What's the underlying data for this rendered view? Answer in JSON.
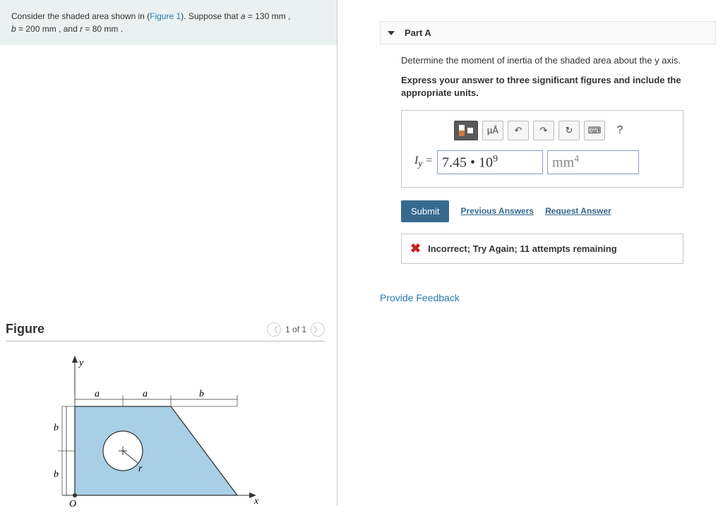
{
  "problem": {
    "text_prefix": "Consider the shaded area shown in (",
    "figure_link": "Figure 1",
    "text_suffix": "). Suppose that ",
    "a_label": "a",
    "a_value": " = 130  mm",
    "sep1": " , ",
    "b_label": "b",
    "b_value": " = 200  mm",
    "sep2": " , and ",
    "r_label": "r",
    "r_value": " = 80  mm",
    "tail": " ."
  },
  "figure": {
    "title": "Figure",
    "nav_text": "1 of 1",
    "labels": {
      "y": "y",
      "x": "x",
      "O": "O",
      "a": "a",
      "b": "b",
      "r": "r"
    }
  },
  "part": {
    "label": "Part A",
    "question": "Determine the moment of inertia of the shaded area about the y axis.",
    "instruction": "Express your answer to three significant figures and include the appropriate units."
  },
  "toolbar": {
    "units_btn": "µÅ",
    "undo": "↶",
    "redo": "↷",
    "reset": "↻",
    "keyboard": "⌨",
    "help": "?"
  },
  "answer": {
    "symbol": "I",
    "subscript": "y",
    "equals": " = ",
    "value": "7.45 • 10",
    "value_exp": "9",
    "units": "mm",
    "units_exp": "4"
  },
  "actions": {
    "submit": "Submit",
    "previous": "Previous Answers",
    "request": "Request Answer"
  },
  "feedback": {
    "icon": "✖",
    "text": "Incorrect; Try Again; 11 attempts remaining"
  },
  "links": {
    "provide_feedback": "Provide Feedback"
  },
  "chart_data": {
    "type": "diagram",
    "shape": "composite-area",
    "parameters": {
      "a_mm": 130,
      "b_mm": 200,
      "r_mm": 80
    },
    "description": "Shaded region: rectangle of width 2a and height 2b on the left adjoined by a right triangle of base b and height 2b on the right, with a circular hole of radius r centered at (a, b). Axes: y vertical along left edge, x horizontal along bottom, origin O at lower-left."
  }
}
